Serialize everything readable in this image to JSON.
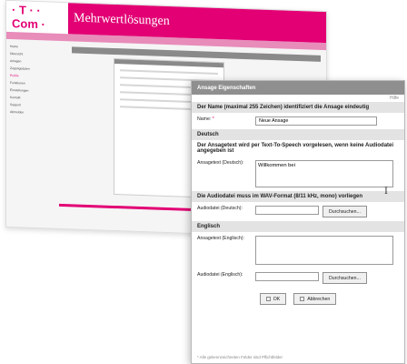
{
  "background": {
    "brand": "· T · · Com ·",
    "title": "Mehrwertlösungen",
    "nav_items": [
      "Home",
      "Übersicht",
      "Anlagen",
      "Zugangsdaten",
      "Profile",
      "Funktionen",
      "Einstellungen",
      "Kontakt",
      "Support",
      "Abmelden"
    ]
  },
  "dialog": {
    "title": "Ansage Eigenschaften",
    "top_link": "Hilfe",
    "intro": "Der Name (maximal 255 Zeichen) identifiziert die Ansage eindeutig",
    "name_label": "Name:",
    "name_value": "Neue Ansage",
    "section_deutsch": "Deutsch",
    "tts_note": "Der Ansagetext wird per Text-To-Speech vorgelesen, wenn keine Audiodatei angegeben ist",
    "ansagetext_de_label": "Ansagetext (Deutsch):",
    "ansagetext_de_value": "Willkommen bei",
    "wav_note": "Die Audiodatei muss im WAV-Format (8/11 kHz, mono) vorliegen",
    "audiodatei_de_label": "Audiodatei (Deutsch):",
    "browse_label": "Durchsuchen...",
    "section_englisch": "Englisch",
    "ansagetext_en_label": "Ansagetext (Englisch):",
    "audiodatei_en_label": "Audiodatei (Englisch):",
    "ok_label": "OK",
    "cancel_label": "Abbrechen",
    "footer_note": "* Alle gekennzeichneten Felder sind Pflichtfelder"
  }
}
